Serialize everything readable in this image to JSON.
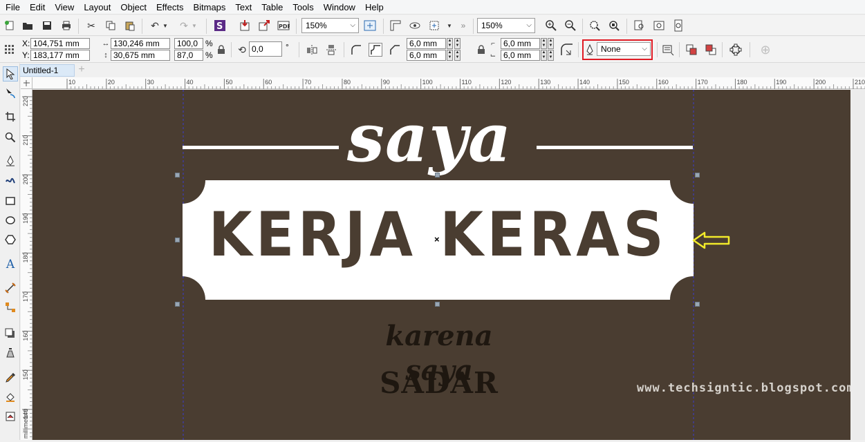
{
  "menu": [
    "File",
    "Edit",
    "View",
    "Layout",
    "Object",
    "Effects",
    "Bitmaps",
    "Text",
    "Table",
    "Tools",
    "Window",
    "Help"
  ],
  "toolbar": {
    "zoom_left": "150%",
    "zoom_right": "150%"
  },
  "propbar": {
    "x_label": "X:",
    "x_value": "104,751 mm",
    "y_label": "Y:",
    "y_value": "183,177 mm",
    "width_value": "130,246 mm",
    "height_value": "30,675 mm",
    "scale_x": "100,0",
    "scale_y": "87,0",
    "percent": "%",
    "rotation": "0,0",
    "degree": "°",
    "corner_1": "6,0 mm",
    "corner_2": "6,0 mm",
    "corner_3": "6,0 mm",
    "corner_4": "6,0 mm",
    "outline": "None"
  },
  "document": {
    "tab_title": "Untitled-1"
  },
  "ruler": {
    "h_ticks": [
      "10",
      "20",
      "30",
      "40",
      "50",
      "60",
      "70",
      "80",
      "90",
      "100",
      "110",
      "120",
      "130",
      "140",
      "150",
      "160",
      "170",
      "180",
      "190",
      "200",
      "210"
    ],
    "v_ticks": [
      "220",
      "210",
      "200",
      "190",
      "180",
      "170",
      "160",
      "150",
      "140"
    ],
    "v_unit": "millimeters"
  },
  "design": {
    "script_top": "saya",
    "headline": "KERJA KERAS",
    "script_mid": "karena saya",
    "bold_word": "SADAR",
    "watermark": "www.techsigntic.blogspot.com"
  },
  "colors": {
    "artboard": "#4a3d31",
    "text_white": "#ffffff",
    "highlight_red": "#e01b24",
    "arrow_yellow": "#f2ea2a"
  }
}
